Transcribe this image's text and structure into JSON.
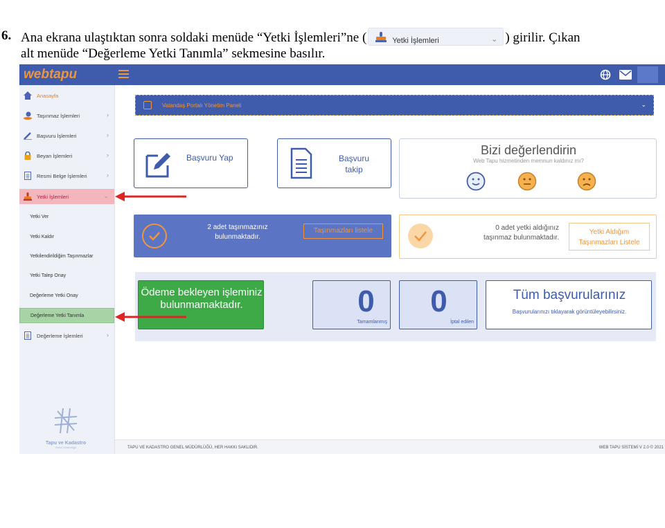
{
  "instruction": {
    "number": "6.",
    "line1_before": "Ana ekrana ulaştıktan sonra soldaki menüde “Yetki İşlemleri”ne (",
    "line1_after": ") girilir. Çıkan",
    "line2": "alt menüde “Değerleme Yetki Tanımla” sekmesine basılır.",
    "chip_label": "Yetki İşlemleri"
  },
  "app": {
    "brand_web": "web",
    "brand_tapu": "tapu"
  },
  "sidebar": {
    "items": [
      {
        "label": "Anasayfa",
        "icon": "home-icon"
      },
      {
        "label": "Taşınmaz İşlemleri",
        "icon": "map-pin-icon"
      },
      {
        "label": "Başvuru İşlemleri",
        "icon": "pen-icon"
      },
      {
        "label": "Beyan İşlemleri",
        "icon": "lock-icon"
      },
      {
        "label": "Resmi Belge İşlemleri",
        "icon": "document-icon"
      },
      {
        "label": "Yetki İşlemleri",
        "icon": "stamp-icon"
      }
    ],
    "sub_items": [
      {
        "label": "Yetki Ver"
      },
      {
        "label": "Yetki Kaldır"
      },
      {
        "label": "Yetkilendirildiğim Taşınmazlar"
      },
      {
        "label": "Yetki Talep Onay"
      },
      {
        "label": "Değerleme Yetki Onay"
      },
      {
        "label": "Değerleme Yetki Tanımla"
      }
    ],
    "last_item": {
      "label": "Değerleme İşlemleri",
      "icon": "document-icon"
    },
    "org_logo_line1": "Tapu ve Kadastro",
    "org_logo_line2": "Genel Müdürlüğü"
  },
  "main": {
    "panel_title": "Vatandaş Portalı Yönetim Paneli",
    "card_apply": "Başvuru Yap",
    "card_track_line1": "Başvuru",
    "card_track_line2": "takip",
    "rate_title": "Bizi değerlendirin",
    "rate_subtitle": "Web Tapu hizmetinden memnun kaldınız mı?",
    "props_text_line1": "2 adet taşınmazınız",
    "props_text_line2": "bulunmaktadır.",
    "props_button": "Taşınmazları listele",
    "auth_text_line1": "0 adet yetki aldığınız",
    "auth_text_line2": "taşınmaz bulunmaktadır.",
    "auth_button_line1": "Yetki Aldığım",
    "auth_button_line2": "Taşınmazları Listele",
    "payment_line1": "Ödeme bekleyen işleminiz",
    "payment_line2": "bulunmamaktadır.",
    "completed_count": "0",
    "completed_label": "Tamamlanmış",
    "cancelled_count": "0",
    "cancelled_label": "İptal edilen",
    "all_apps_title": "Tüm başvurularınız",
    "all_apps_subtitle": "Başvurularınızı tıklayarak görüntüleyebilirsiniz."
  },
  "footer": {
    "left": "TAPU VE KADASTRO GENEL MÜDÜRLÜĞÜ, HER HAKKI SAKLIDIR.",
    "right": "WEB TAPU SİSTEMİ V 2.0 © 2021"
  },
  "colors": {
    "primary": "#3f5bab",
    "accent_orange": "#f0953a",
    "highlight_red": "#f4b6bd",
    "highlight_green": "#a8d3a7",
    "success": "#3daa47",
    "annotation_arrow": "#e02424"
  }
}
